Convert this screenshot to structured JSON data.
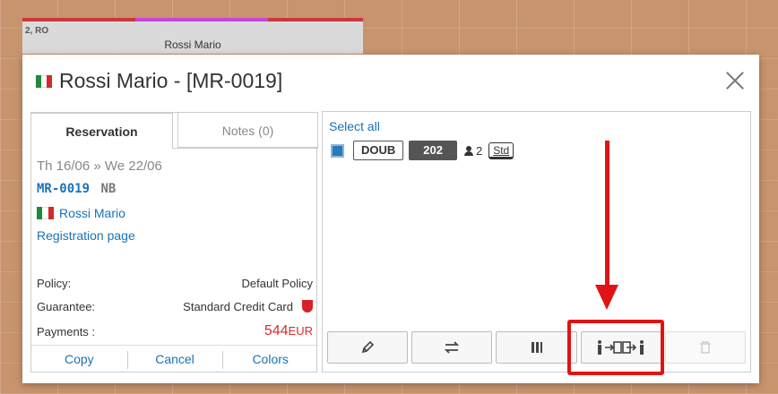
{
  "background_reservation": {
    "code": "2, RO",
    "guest_name": "Rossi Mario"
  },
  "modal": {
    "title": "Rossi Mario - [MR-0019]",
    "flag": "italy-flag"
  },
  "tabs": {
    "reservation": "Reservation",
    "notes": "Notes (0)"
  },
  "details": {
    "dates": "Th 16/06 » We 22/06",
    "res_code": "MR-0019",
    "res_status": "NB",
    "guest_link": "Rossi Mario",
    "registration_link": "Registration page",
    "policy_label": "Policy:",
    "policy_value": "Default Policy",
    "guarantee_label": "Guarantee:",
    "guarantee_value": "Standard Credit Card",
    "payments_label": "Payments :",
    "payments_amount": "544",
    "payments_currency": "EUR"
  },
  "left_actions": {
    "copy": "Copy",
    "cancel": "Cancel",
    "colors": "Colors"
  },
  "rooms": {
    "select_all": "Select all",
    "items": [
      {
        "type": "DOUB",
        "number": "202",
        "guests": "2",
        "rate": "Std",
        "checked": true
      }
    ]
  },
  "toolbar": {
    "buttons": [
      {
        "icon": "pencil-icon"
      },
      {
        "icon": "swap-arrows-icon"
      },
      {
        "icon": "split-columns-icon"
      },
      {
        "icon": "move-guest-icon"
      },
      {
        "icon": "trash-icon",
        "disabled": true
      }
    ]
  },
  "colors": {
    "accent": "#1a72b8",
    "payment": "#d92b2b",
    "highlight": "#e01414"
  }
}
